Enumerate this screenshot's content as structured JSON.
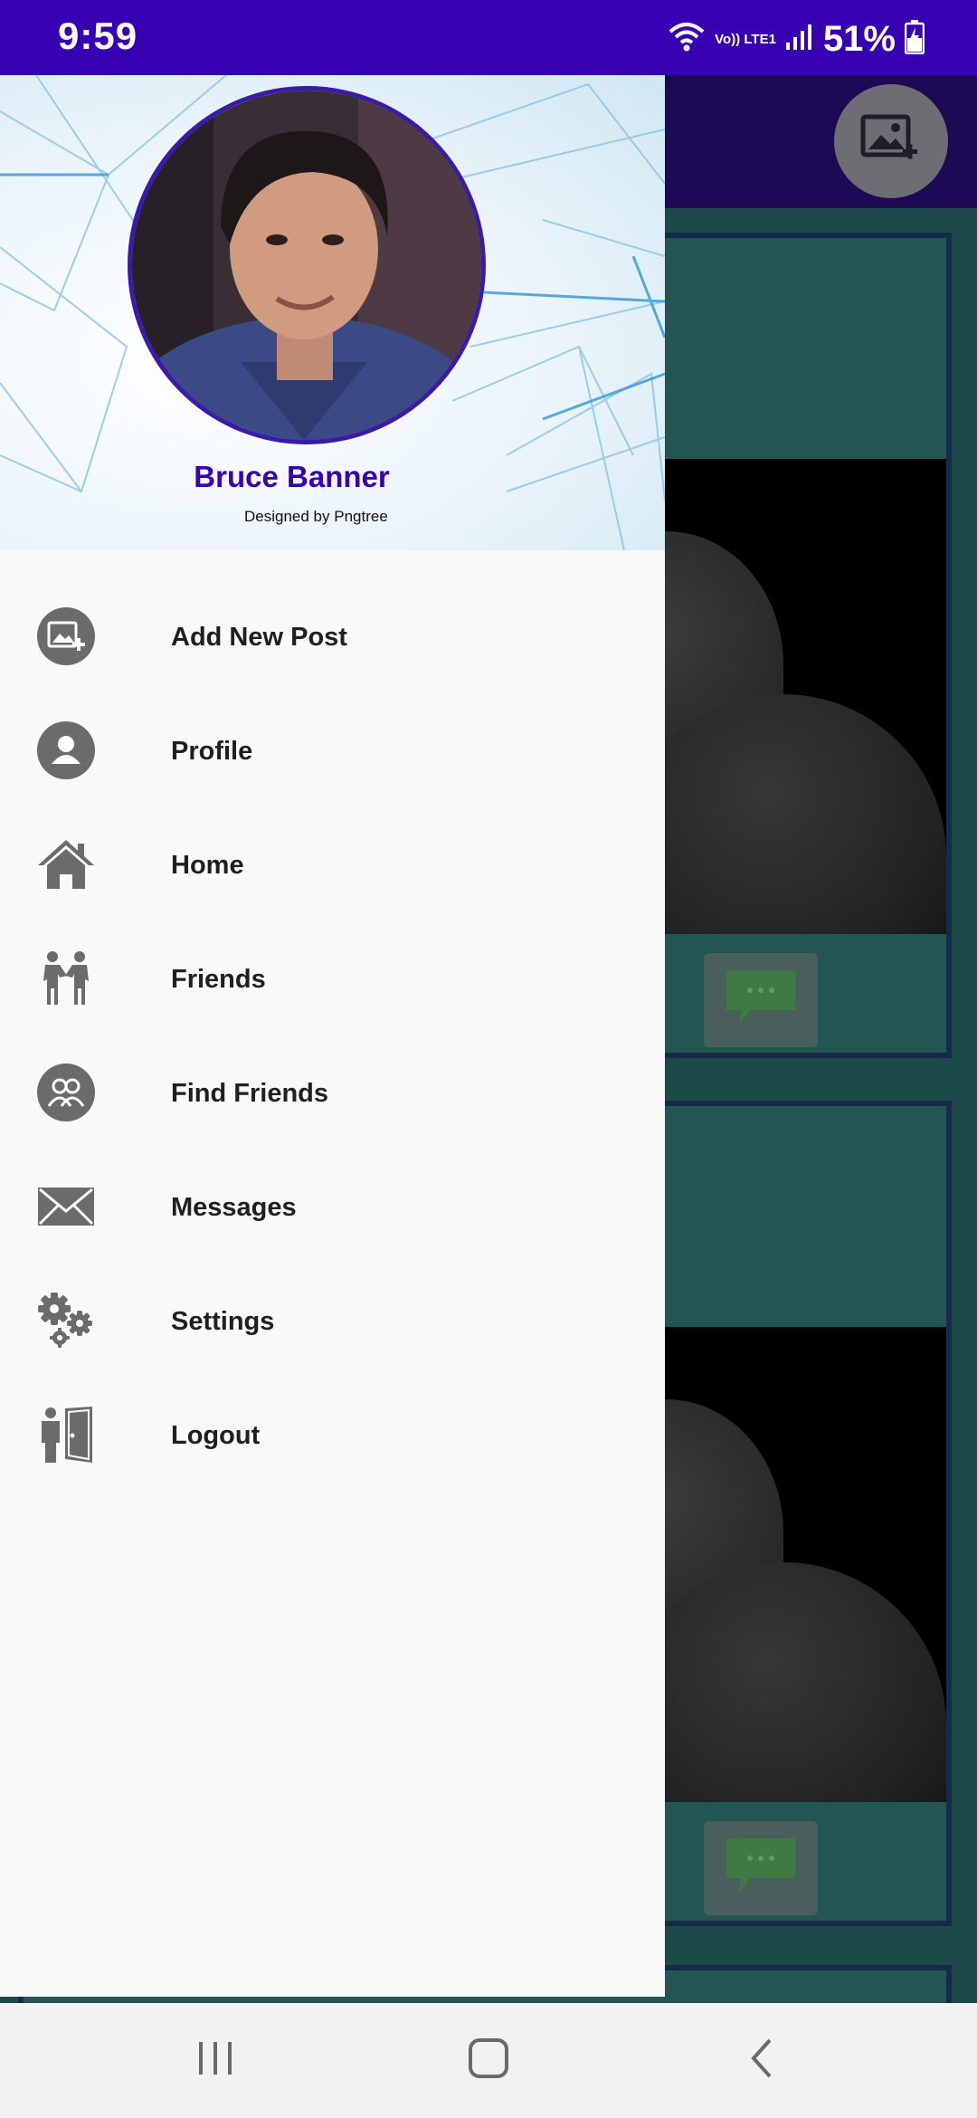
{
  "status_bar": {
    "time": "9:59",
    "network_label": "Vo)) LTE1",
    "battery": "51%",
    "bg_color": "#3700b3"
  },
  "background_app": {
    "fab_icon": "add-image-icon",
    "posts": [
      {
        "comment_icon": "comment-bubble-icon"
      },
      {
        "comment_icon": "comment-bubble-icon"
      }
    ]
  },
  "drawer": {
    "header": {
      "user_name": "Bruce Banner",
      "credit": "Designed by Pngtree",
      "avatar": "profile-photo"
    },
    "menu": [
      {
        "label": "Add New Post",
        "icon": "add-image-icon"
      },
      {
        "label": "Profile",
        "icon": "person-icon"
      },
      {
        "label": "Home",
        "icon": "home-icon"
      },
      {
        "label": "Friends",
        "icon": "friends-icon"
      },
      {
        "label": "Find Friends",
        "icon": "find-friends-icon"
      },
      {
        "label": "Messages",
        "icon": "envelope-icon"
      },
      {
        "label": "Settings",
        "icon": "gears-icon"
      },
      {
        "label": "Logout",
        "icon": "logout-icon"
      }
    ]
  },
  "nav_bar": {
    "recents": "recents-icon",
    "home": "home-button-icon",
    "back": "back-icon"
  },
  "colors": {
    "accent": "#3700b3",
    "drawer_bg": "#f9f9f9",
    "icon_gray": "#6b6b6b",
    "post_bg": "#235652"
  }
}
